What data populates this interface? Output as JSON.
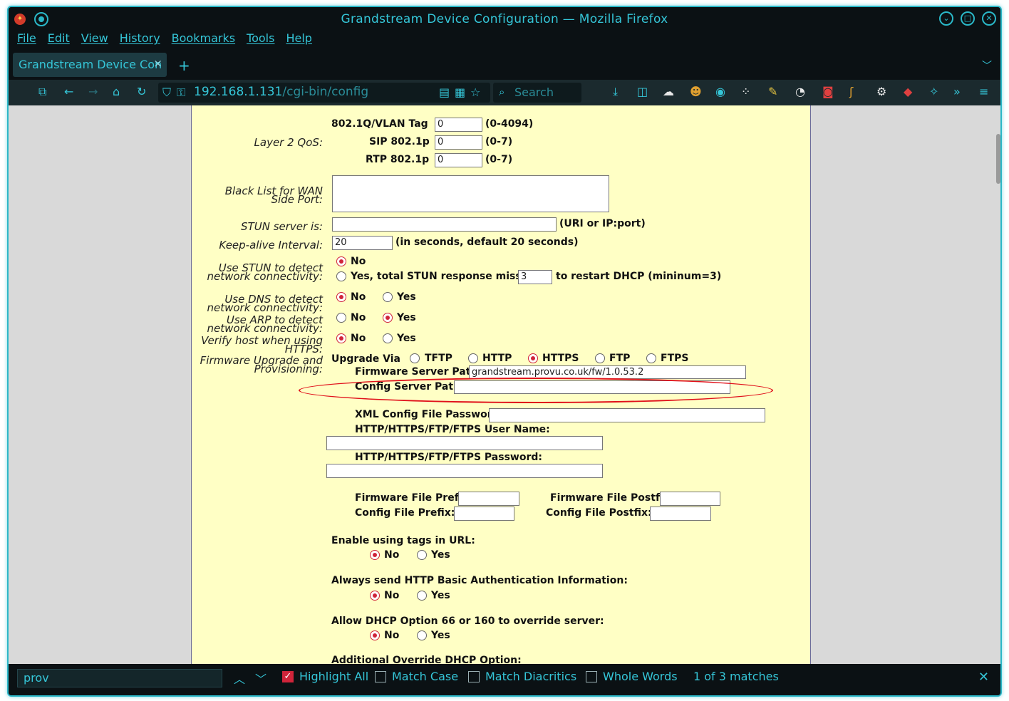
{
  "window": {
    "title": "Grandstream Device Configuration — Mozilla Firefox",
    "accent": "#35c6d8"
  },
  "menu": [
    "File",
    "Edit",
    "View",
    "History",
    "Bookmarks",
    "Tools",
    "Help"
  ],
  "tab": {
    "label": "Grandstream Device Con",
    "close": "×",
    "new_tab": "+"
  },
  "address": {
    "host": "192.168.1.131",
    "path": "/cgi-bin/config"
  },
  "search": {
    "placeholder": "Search"
  },
  "form": {
    "layer2": {
      "label": "Layer 2 QoS:",
      "vlan_label": "802.1Q/VLAN Tag",
      "vlan_value": "0",
      "vlan_range": "(0-4094)",
      "sip_label": "SIP 802.1p",
      "sip_value": "0",
      "sip_range": "(0-7)",
      "rtp_label": "RTP 802.1p",
      "rtp_value": "0",
      "rtp_range": "(0-7)"
    },
    "blacklist_label": "Black List for WAN Side Port:",
    "stun_label": "STUN server is:",
    "stun_hint": "(URI or IP:port)",
    "keepalive_label": "Keep-alive Interval:",
    "keepalive_value": "20",
    "keepalive_hint": "(in seconds, default 20 seconds)",
    "use_stun": {
      "label": "Use STUN to detect network connectivity:",
      "no": "No",
      "yes": "Yes, total STUN response misses",
      "misses_value": "3",
      "suffix": "to restart DHCP (mininum=3)"
    },
    "use_dns": {
      "label": "Use DNS to detect network connectivity:",
      "no": "No",
      "yes": "Yes"
    },
    "use_arp": {
      "label": "Use ARP to detect network connectivity:",
      "no": "No",
      "yes": "Yes"
    },
    "verify_host": {
      "label": "Verify host when using HTTPS:",
      "no": "No",
      "yes": "Yes"
    },
    "firmware": {
      "label": "Firmware Upgrade and Provisioning:",
      "upgrade_via": "Upgrade Via",
      "options": [
        "TFTP",
        "HTTP",
        "HTTPS",
        "FTP",
        "FTPS"
      ],
      "selected": "HTTPS",
      "fw_path_label": "Firmware Server Path:",
      "fw_path_value": "grandstream.provu.co.uk/fw/1.0.53.2",
      "cfg_path_label": "Config Server Path:",
      "cfg_path_value": "",
      "xml_pw_label": "XML Config File Password:",
      "user_label": "HTTP/HTTPS/FTP/FTPS User Name:",
      "pw_label": "HTTP/HTTPS/FTP/FTPS Password:",
      "fw_prefix_label": "Firmware File Prefix:",
      "fw_postfix_label": "Firmware File Postfix:",
      "cfg_prefix_label": "Config File Prefix:",
      "cfg_postfix_label": "Config File Postfix:"
    },
    "tags_url": {
      "label": "Enable using tags in URL:",
      "no": "No",
      "yes": "Yes"
    },
    "basic_auth": {
      "label": "Always send HTTP Basic Authentication Information:",
      "no": "No",
      "yes": "Yes"
    },
    "dhcp66": {
      "label": "Allow DHCP Option 66 or 160 to override server:",
      "no": "No",
      "yes": "Yes"
    },
    "additional": {
      "label": "Additional Override DHCP Option:"
    }
  },
  "findbar": {
    "query": "prov",
    "highlight_all": "Highlight All",
    "match_case": "Match Case",
    "match_diacritics": "Match Diacritics",
    "whole_words": "Whole Words",
    "status": "1 of 3 matches"
  }
}
